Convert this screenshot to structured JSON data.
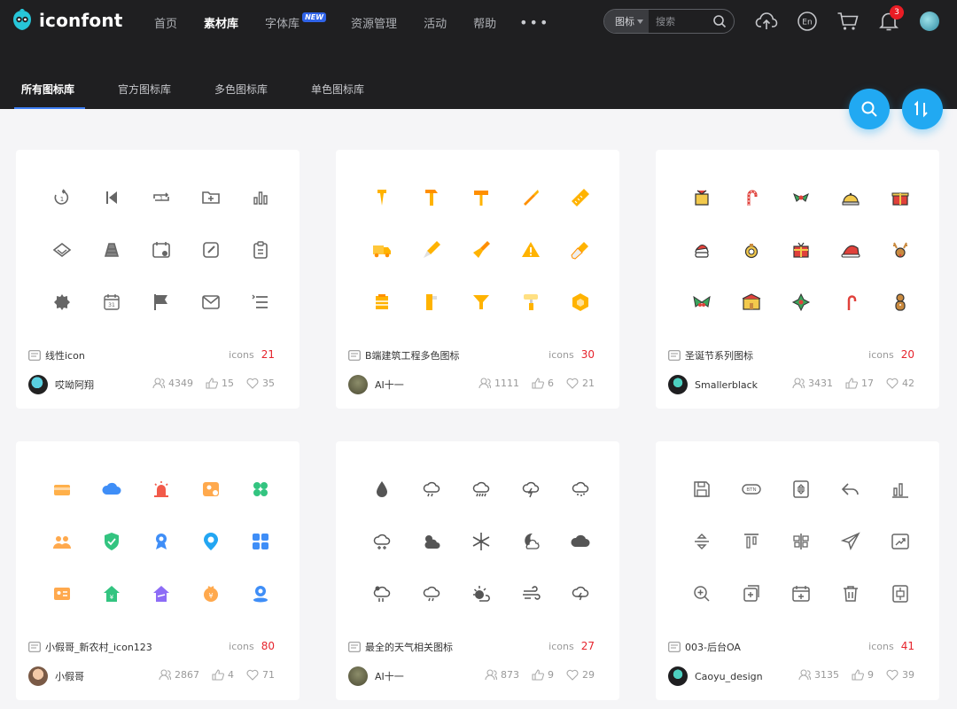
{
  "brand": {
    "name": "iconfont",
    "accent": "#3e7ff4"
  },
  "nav": {
    "items": [
      {
        "label": "首页",
        "active": false
      },
      {
        "label": "素材库",
        "active": true
      },
      {
        "label": "字体库",
        "active": false,
        "badge": "NEW"
      },
      {
        "label": "资源管理",
        "active": false
      },
      {
        "label": "活动",
        "active": false
      },
      {
        "label": "帮助",
        "active": false
      }
    ],
    "more": "•••"
  },
  "search": {
    "type_label": "图标",
    "placeholder": "搜索"
  },
  "notifications": {
    "count": "3"
  },
  "subtabs": [
    {
      "label": "所有图标库",
      "active": true
    },
    {
      "label": "官方图标库",
      "active": false
    },
    {
      "label": "多色图标库",
      "active": false
    },
    {
      "label": "单色图标库",
      "active": false
    }
  ],
  "fab_sort_label": "1↓",
  "cards": [
    {
      "title": "线性icon",
      "icons_label": "icons",
      "count": "21",
      "user": "哎呦阿翔",
      "views": "4349",
      "likes": "15",
      "favs": "35",
      "style": "line"
    },
    {
      "title": "B端建筑工程多色图标",
      "icons_label": "icons",
      "count": "30",
      "user": "AI十一",
      "views": "1111",
      "likes": "6",
      "favs": "21",
      "style": "orange"
    },
    {
      "title": "圣诞节系列图标",
      "icons_label": "icons",
      "count": "20",
      "user": "Smallerblack",
      "views": "3431",
      "likes": "17",
      "favs": "42",
      "style": "xmas"
    },
    {
      "title": "小假哥_新农村_icon123",
      "icons_label": "icons",
      "count": "80",
      "user": "小假哥",
      "views": "2867",
      "likes": "4",
      "favs": "71",
      "style": "flat"
    },
    {
      "title": "最全的天气相关图标",
      "icons_label": "icons",
      "count": "27",
      "user": "AI十一",
      "views": "873",
      "likes": "9",
      "favs": "29",
      "style": "weather"
    },
    {
      "title": "003-后台OA",
      "icons_label": "icons",
      "count": "41",
      "user": "Caoyu_design",
      "views": "3135",
      "likes": "9",
      "favs": "39",
      "style": "oa"
    }
  ]
}
